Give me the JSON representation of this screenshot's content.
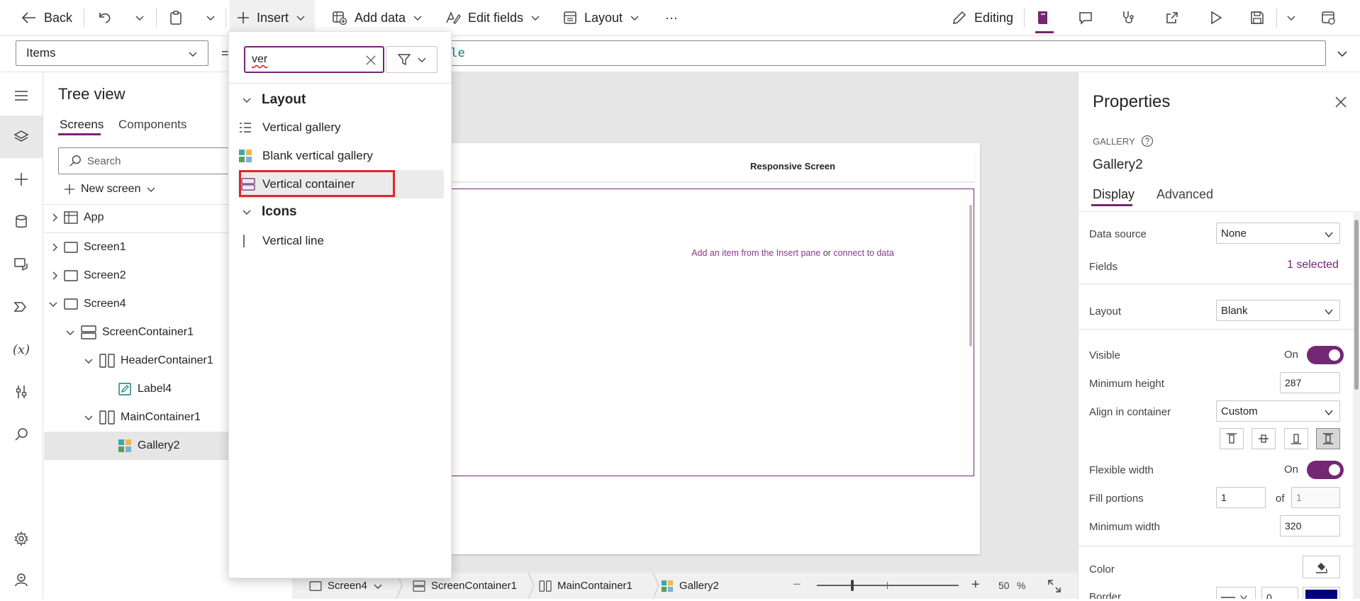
{
  "toolbar": {
    "back": "Back",
    "insert": "Insert",
    "add_data": "Add data",
    "edit_fields": "Edit fields",
    "layout": "Layout",
    "more": "···",
    "editing": "Editing"
  },
  "formula": {
    "property": "Items",
    "equals": "=",
    "expression": "ple"
  },
  "tree": {
    "title": "Tree view",
    "tabs": [
      "Screens",
      "Components"
    ],
    "search_placeholder": "Search",
    "new_screen": "New screen",
    "items": [
      "App",
      "Screen1",
      "Screen2",
      "Screen4",
      "ScreenContainer1",
      "HeaderContainer1",
      "Label4",
      "MainContainer1",
      "Gallery2"
    ]
  },
  "canvas": {
    "header_title": "Responsive Screen",
    "empty_text_1": "Add an item from the Insert pane",
    "empty_or": " or ",
    "empty_link": "connect to data"
  },
  "statusbar": {
    "crumbs": [
      "Screen4",
      "ScreenContainer1",
      "MainContainer1",
      "Gallery2"
    ],
    "zoom_value": "50",
    "zoom_unit": "%",
    "zoom_minus": "−",
    "zoom_plus": "+"
  },
  "insert_flyout": {
    "search_value": "ver",
    "sections": [
      {
        "title": "Layout",
        "items": [
          "Vertical gallery",
          "Blank vertical gallery",
          "Vertical container"
        ]
      },
      {
        "title": "Icons",
        "items": [
          "Vertical line"
        ]
      }
    ]
  },
  "properties": {
    "title": "Properties",
    "control_type": "GALLERY",
    "control_name": "Gallery2",
    "tabs": [
      "Display",
      "Advanced"
    ],
    "rows": {
      "data_source_label": "Data source",
      "data_source_value": "None",
      "fields_label": "Fields",
      "fields_value": "1 selected",
      "layout_label": "Layout",
      "layout_value": "Blank",
      "visible_label": "Visible",
      "visible_value": "On",
      "min_height_label": "Minimum height",
      "min_height_value": "287",
      "align_label": "Align in container",
      "align_value": "Custom",
      "flex_width_label": "Flexible width",
      "flex_width_value": "On",
      "fill_label": "Fill portions",
      "fill_value": "1",
      "fill_of": "of",
      "fill_total": "1",
      "min_width_label": "Minimum width",
      "min_width_value": "320",
      "color_label": "Color",
      "border_label": "Border",
      "border_value": "0"
    }
  },
  "colors": {
    "accent": "#742774",
    "highlight": "#e3242b",
    "canvas_bg": "#e6e6e6",
    "border_color": "#000080"
  }
}
